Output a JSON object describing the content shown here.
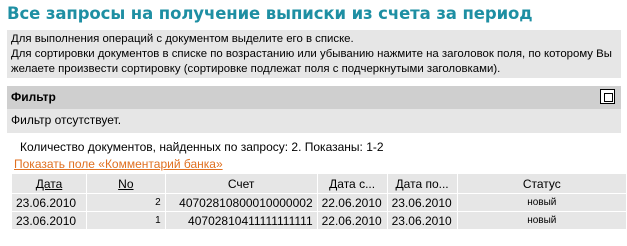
{
  "page_title": "Все запросы на получение выписки из счета за период",
  "info": {
    "line1": "Для выполнения операций с документом выделите его в списке.",
    "line2": "Для сортировки документов в списке по возрастанию или убыванию нажмите на заголовок поля, по которому Вы",
    "line3": "желаете произвести сортировку (сортировке подлежат поля с подчеркнутыми заголовками)."
  },
  "filter": {
    "label": "Фильтр",
    "state_text": "Фильтр отсутствует."
  },
  "count_text": "Количество  документов, найденных по запросу:  2.   Показаны:  1-2",
  "show_comment_link": "Показать поле «Комментарий банка»",
  "table": {
    "headers": {
      "date": "Дата",
      "no": "No",
      "account": "Счет",
      "date_from": "Дата с...",
      "date_to": "Дата по...",
      "status": "Статус"
    },
    "rows": [
      {
        "date": "23.06.2010",
        "no": "2",
        "account": "40702810800010000002",
        "date_from": "22.06.2010",
        "date_to": "23.06.2010",
        "status": "новый"
      },
      {
        "date": "23.06.2010",
        "no": "1",
        "account": "40702810411111111111",
        "date_from": "22.06.2010",
        "date_to": "23.06.2010",
        "status": "новый"
      }
    ]
  }
}
